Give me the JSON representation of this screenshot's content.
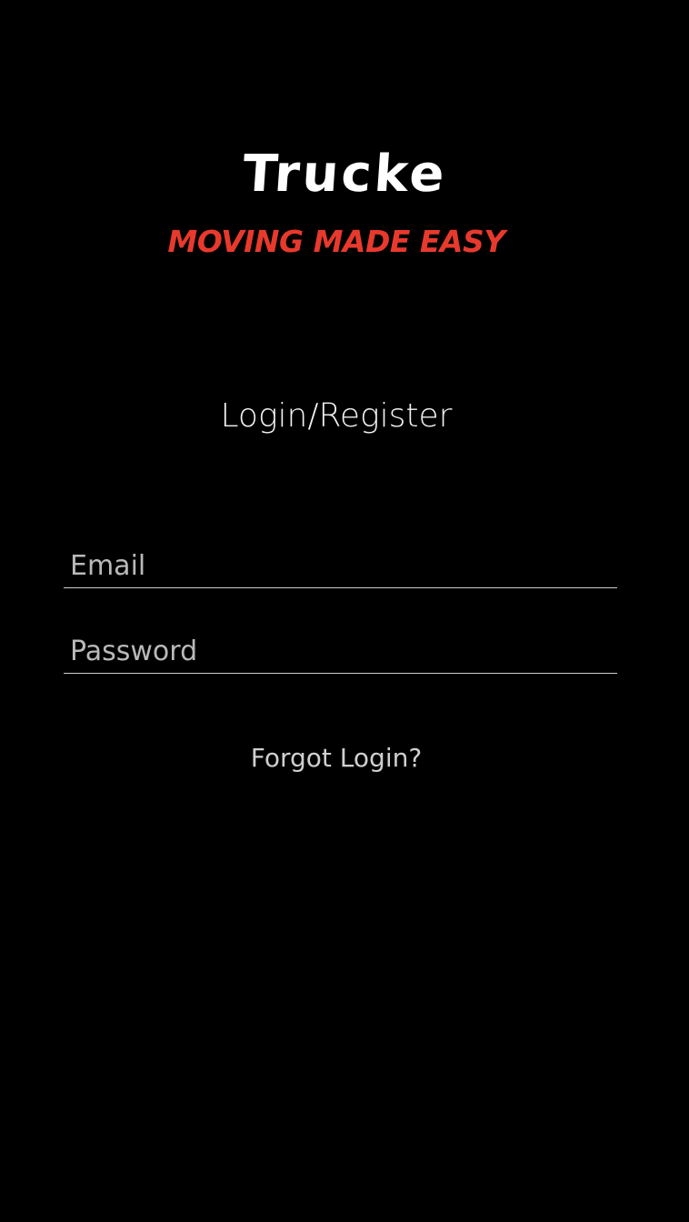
{
  "brand": {
    "logo_text": "Trucke",
    "tagline": "MOVING MADE EASY"
  },
  "login": {
    "heading": "Login/Register",
    "email_placeholder": "Email",
    "password_placeholder": "Password",
    "forgot_label": "Forgot Login?"
  },
  "colors": {
    "background": "#000000",
    "accent": "#e8392d",
    "text": "#ffffff"
  }
}
